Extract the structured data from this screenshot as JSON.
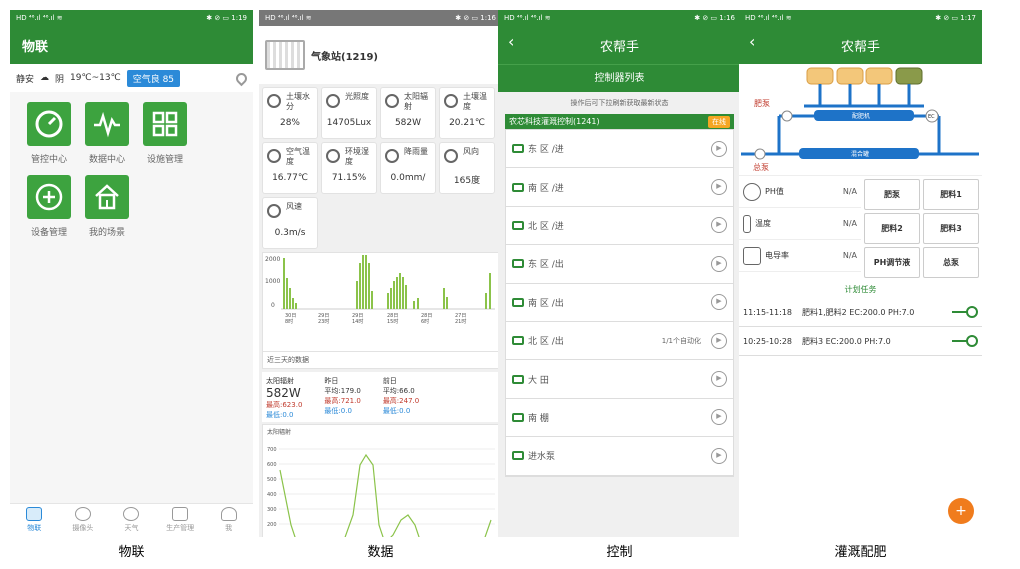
{
  "captions": [
    "物联",
    "数据",
    "控制",
    "灌溉配肥"
  ],
  "status": {
    "s1": {
      "left": "HD ⁴⁶.ıl ⁴⁶.ıl ≋",
      "right": "✱ ⊘ ▭ 1:19"
    },
    "s2": {
      "left": "HD ⁴⁶.ıl ⁴⁶.ıl ≋",
      "right": "✱ ⊘ ▭ 1:16"
    },
    "s3": {
      "left": "HD ⁴⁶.ıl ⁴⁶.ıl ≋",
      "right": "✱ ⊘ ▭ 1:16"
    },
    "s4": {
      "left": "HD ⁴⁶.ıl ⁴⁶.ıl ≋",
      "right": "✱ ⊘ ▭ 1:17"
    }
  },
  "home": {
    "title": "物联",
    "city": "静安",
    "weather": "阴",
    "temp": "19℃~13℃",
    "aqi": "空气良 85",
    "tiles": [
      "管控中心",
      "数据中心",
      "设施管理",
      "设备管理",
      "我的场景"
    ],
    "nav": [
      "物联",
      "摄像头",
      "天气",
      "生产管理",
      "我"
    ]
  },
  "data": {
    "station": "气象站(1219)",
    "sensors": [
      {
        "name": "土壤水分",
        "value": "28%"
      },
      {
        "name": "光照度",
        "value": "14705Lux"
      },
      {
        "name": "太阳辐射",
        "value": "582W"
      },
      {
        "name": "土壤温度",
        "value": "20.21℃"
      },
      {
        "name": "空气温度",
        "value": "16.77℃"
      },
      {
        "name": "环境湿度",
        "value": "71.15%"
      },
      {
        "name": "降雨量",
        "value": "0.0mm/"
      },
      {
        "name": "风向",
        "value": "165度"
      },
      {
        "name": "风速",
        "value": "0.3m/s"
      }
    ],
    "chart_yticks": [
      "2000",
      "1000",
      "0"
    ],
    "chart_xticks": [
      "30日\n8时",
      "29日\n23时",
      "29日\n14时",
      "28日\n15时",
      "28日\n6时",
      "27日\n21时"
    ],
    "chart_note": "近三天的数据",
    "radiation": {
      "name": "太阳辐射",
      "value": "582W",
      "today_max": "最高:623.0",
      "today_min": "最低:0.0",
      "yesterday": "昨日",
      "y_avg": "平均:179.0",
      "y_max": "最高:721.0",
      "y_min": "最低:0.0",
      "before": "前日",
      "b_avg": "平均:66.0",
      "b_max": "最高:247.0",
      "b_min": "最低:0.0"
    },
    "chart2_title": "太阳辐射",
    "chart2_yticks": [
      "700",
      "600",
      "500",
      "400",
      "300",
      "200",
      "100"
    ]
  },
  "control": {
    "title": "农帮手",
    "subtitle": "控制器列表",
    "hint": "操作后可下拉刷新获取最新状态",
    "controller": "农芯科技灌溉控制(1241)",
    "online": "在线",
    "rows": [
      {
        "label": "东 区 /进",
        "auto": ""
      },
      {
        "label": "南 区 /进",
        "auto": ""
      },
      {
        "label": "北 区 /进",
        "auto": ""
      },
      {
        "label": "东 区 /出",
        "auto": ""
      },
      {
        "label": "南 区 /出",
        "auto": ""
      },
      {
        "label": "北 区 /出",
        "auto": "1/1个自动化"
      },
      {
        "label": "大 田",
        "auto": ""
      },
      {
        "label": "南 棚",
        "auto": ""
      },
      {
        "label": "进水泵",
        "auto": ""
      }
    ]
  },
  "fert": {
    "title": "农帮手",
    "label_fert_pump": "肥泵",
    "label_main_pump": "总泵",
    "label_mixer": "配肥机",
    "label_mix_tank": "混合罐",
    "label_ec": "EC",
    "params": [
      {
        "name": "PH值",
        "value": "N/A"
      },
      {
        "name": "温度",
        "value": "N/A"
      },
      {
        "name": "电导率",
        "value": "N/A"
      }
    ],
    "buttons": [
      "肥泵",
      "肥料1",
      "肥料2",
      "肥料3",
      "PH调节液",
      "总泵"
    ],
    "plan_title": "计划任务",
    "tasks": [
      {
        "time": "11:15-11:18",
        "desc": "肥料1,肥料2 EC:200.0 PH:7.0"
      },
      {
        "time": "10:25-10:28",
        "desc": "肥料3 EC:200.0 PH:7.0"
      }
    ],
    "fab": "+"
  }
}
